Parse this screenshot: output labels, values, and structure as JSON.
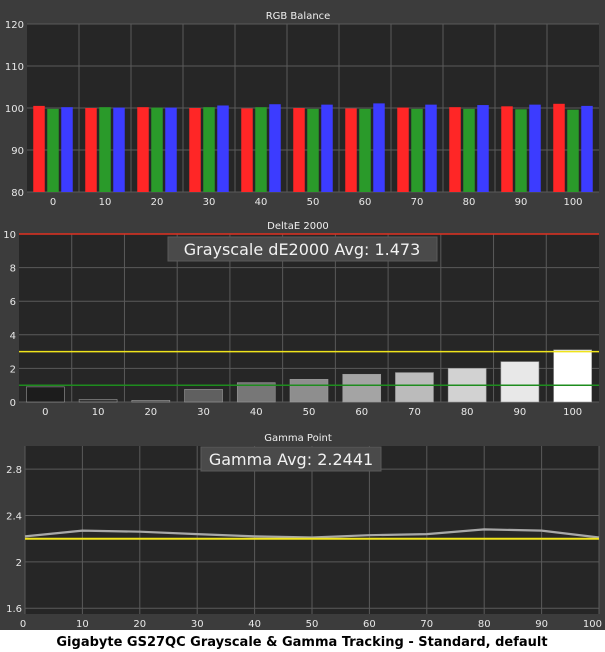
{
  "caption": "Gigabyte GS27QC Grayscale & Gamma Tracking - Standard, default",
  "colors": {
    "panel_bg": "#3c3c3c",
    "plot_bg": "#262626",
    "grid": "#5a5a5a",
    "red": "#ff2626",
    "green": "#2a9a2a",
    "blue": "#3c3cff",
    "yellow": "#f0e41c",
    "limit_red": "#e03020",
    "dark_green": "#1e8c1e",
    "gamma_gray": "#a8a8a8"
  },
  "chart_data": [
    {
      "type": "bar",
      "title": "RGB Balance",
      "categories": [
        "0",
        "10",
        "20",
        "30",
        "40",
        "50",
        "60",
        "70",
        "80",
        "90",
        "100"
      ],
      "series": [
        {
          "name": "",
          "color": "red",
          "values": [
            100.5,
            100.0,
            100.2,
            100.0,
            99.9,
            100.0,
            99.9,
            100.1,
            100.2,
            100.4,
            101.0
          ]
        },
        {
          "name": "",
          "color": "green",
          "values": [
            99.8,
            100.2,
            100.1,
            100.2,
            100.2,
            99.8,
            99.8,
            99.8,
            99.8,
            99.7,
            99.6
          ]
        },
        {
          "name": "",
          "color": "blue",
          "values": [
            100.2,
            100.1,
            100.1,
            100.6,
            100.9,
            100.8,
            101.1,
            100.8,
            100.7,
            100.8,
            100.5
          ]
        }
      ],
      "ylim": [
        80,
        120
      ],
      "yticks": [
        "80",
        "90",
        "100",
        "110",
        "120"
      ],
      "grid": true
    },
    {
      "type": "bar",
      "title": "DeltaE 2000",
      "annotation": "Grayscale dE2000 Avg: 1.473",
      "categories": [
        "0",
        "10",
        "20",
        "30",
        "40",
        "50",
        "60",
        "70",
        "80",
        "90",
        "100"
      ],
      "values": [
        0.9,
        0.15,
        0.1,
        0.75,
        1.15,
        1.35,
        1.65,
        1.75,
        2.0,
        2.4,
        3.1
      ],
      "ylim": [
        0,
        10
      ],
      "yticks": [
        "0",
        "2",
        "4",
        "6",
        "8",
        "10"
      ],
      "reference_lines": [
        {
          "value": 10,
          "color": "limit_red"
        },
        {
          "value": 3,
          "color": "yellow"
        },
        {
          "value": 1,
          "color": "dark_green"
        }
      ],
      "grid": true
    },
    {
      "type": "line",
      "title": "Gamma Point",
      "annotation": "Gamma Avg: 2.2441",
      "x": [
        0,
        10,
        20,
        30,
        40,
        50,
        60,
        70,
        80,
        90,
        100
      ],
      "xticks": [
        "0",
        "10",
        "20",
        "30",
        "40",
        "50",
        "60",
        "70",
        "80",
        "90",
        "100"
      ],
      "series": [
        {
          "name": "",
          "color": "gamma_gray",
          "values": [
            2.22,
            2.27,
            2.26,
            2.24,
            2.22,
            2.21,
            2.23,
            2.24,
            2.28,
            2.27,
            2.21
          ]
        },
        {
          "name": "",
          "color": "yellow",
          "values": [
            2.2,
            2.2,
            2.2,
            2.2,
            2.2,
            2.2,
            2.2,
            2.2,
            2.2,
            2.2,
            2.2
          ]
        }
      ],
      "ylim": [
        1.55,
        3.0
      ],
      "yticks": [
        "1.6",
        "2",
        "2.4",
        "2.8"
      ],
      "ytick_values": [
        1.6,
        2.0,
        2.4,
        2.8
      ],
      "grid": true
    }
  ]
}
